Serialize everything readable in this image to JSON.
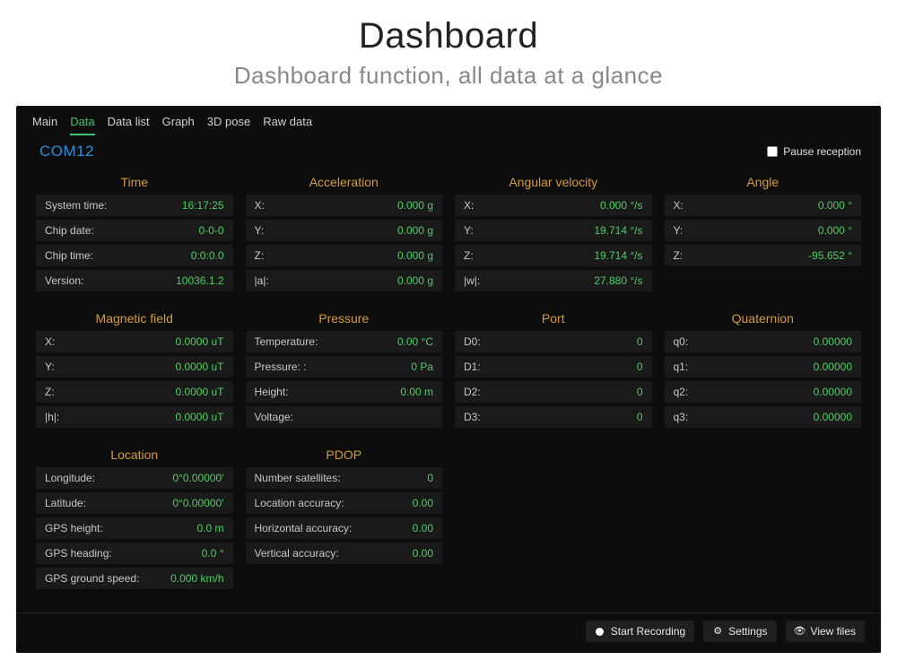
{
  "header": {
    "title": "Dashboard",
    "subtitle": "Dashboard function, all data at a glance"
  },
  "tabs": [
    {
      "label": "Main",
      "active": false
    },
    {
      "label": "Data",
      "active": true
    },
    {
      "label": "Data list",
      "active": false
    },
    {
      "label": "Graph",
      "active": false
    },
    {
      "label": "3D pose",
      "active": false
    },
    {
      "label": "Raw data",
      "active": false
    }
  ],
  "port": "COM12",
  "pause_checkbox": {
    "label": "Pause reception",
    "checked": false
  },
  "groups": [
    {
      "title": "Time",
      "rows": [
        {
          "label": "System time:",
          "value": "16:17:25"
        },
        {
          "label": "Chip date:",
          "value": "0-0-0"
        },
        {
          "label": "Chip time:",
          "value": "0:0:0.0"
        },
        {
          "label": "Version:",
          "value": "10036.1.2"
        }
      ]
    },
    {
      "title": "Acceleration",
      "rows": [
        {
          "label": "X:",
          "value": "0.000 g"
        },
        {
          "label": "Y:",
          "value": "0.000 g"
        },
        {
          "label": "Z:",
          "value": "0.000 g"
        },
        {
          "label": "|a|:",
          "value": "0.000 g"
        }
      ]
    },
    {
      "title": "Angular velocity",
      "rows": [
        {
          "label": "X:",
          "value": "0.000 °/s"
        },
        {
          "label": "Y:",
          "value": "19.714 °/s"
        },
        {
          "label": "Z:",
          "value": "19.714 °/s"
        },
        {
          "label": "|w|:",
          "value": "27.880 °/s"
        }
      ]
    },
    {
      "title": "Angle",
      "rows": [
        {
          "label": "X:",
          "value": "0.000 °"
        },
        {
          "label": "Y:",
          "value": "0.000 °"
        },
        {
          "label": "Z:",
          "value": "-95.652 °"
        }
      ]
    },
    {
      "title": "Magnetic field",
      "rows": [
        {
          "label": "X:",
          "value": "0.0000 uT"
        },
        {
          "label": "Y:",
          "value": "0.0000 uT"
        },
        {
          "label": "Z:",
          "value": "0.0000 uT"
        },
        {
          "label": "|h|:",
          "value": "0.0000 uT"
        }
      ]
    },
    {
      "title": "Pressure",
      "rows": [
        {
          "label": "Temperature:",
          "value": "0.00 °C"
        },
        {
          "label": "Pressure: :",
          "value": "0 Pa"
        },
        {
          "label": "Height:",
          "value": "0.00 m"
        },
        {
          "label": "Voltage:",
          "value": ""
        }
      ]
    },
    {
      "title": "Port",
      "rows": [
        {
          "label": "D0:",
          "value": "0"
        },
        {
          "label": "D1:",
          "value": "0"
        },
        {
          "label": "D2:",
          "value": "0"
        },
        {
          "label": "D3:",
          "value": "0"
        }
      ]
    },
    {
      "title": "Quaternion",
      "rows": [
        {
          "label": "q0:",
          "value": "0.00000"
        },
        {
          "label": "q1:",
          "value": "0.00000"
        },
        {
          "label": "q2:",
          "value": "0.00000"
        },
        {
          "label": "q3:",
          "value": "0.00000"
        }
      ]
    },
    {
      "title": "Location",
      "rows": [
        {
          "label": "Longitude:",
          "value": "0°0.00000'"
        },
        {
          "label": "Latitude:",
          "value": "0°0.00000'"
        },
        {
          "label": "GPS height:",
          "value": "0.0 m"
        },
        {
          "label": "GPS heading:",
          "value": "0.0 °"
        },
        {
          "label": "GPS ground speed:",
          "value": "0.000 km/h"
        }
      ]
    },
    {
      "title": "PDOP",
      "rows": [
        {
          "label": "Number satellites:",
          "value": "0"
        },
        {
          "label": "Location accuracy:",
          "value": "0.00"
        },
        {
          "label": "Horizontal accuracy:",
          "value": "0.00"
        },
        {
          "label": "Vertical accuracy:",
          "value": "0.00"
        }
      ]
    }
  ],
  "footer": {
    "start_recording": "Start Recording",
    "settings": "Settings",
    "view_files": "View files"
  }
}
